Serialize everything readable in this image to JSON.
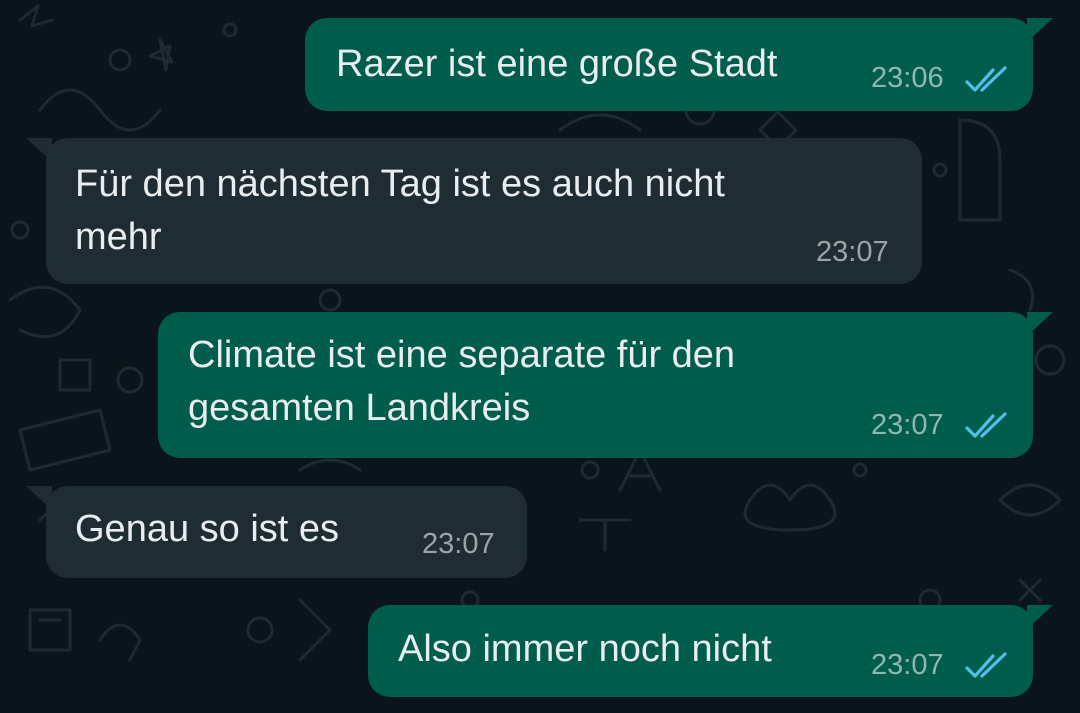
{
  "theme": {
    "background": "#0b141a",
    "outgoing_bubble": "#005c4b",
    "incoming_bubble": "#202c33",
    "text_color": "#e9edef",
    "read_receipt_color": "#53bdeb"
  },
  "messages": [
    {
      "direction": "outgoing",
      "lines": [
        "Razer ist eine große Stadt"
      ],
      "time": "23:06",
      "status": "read"
    },
    {
      "direction": "incoming",
      "lines": [
        "Für den nächsten Tag ist es auch nicht",
        "mehr"
      ],
      "time": "23:07"
    },
    {
      "direction": "outgoing",
      "lines": [
        "Climate ist eine separate für den",
        "gesamten Landkreis"
      ],
      "time": "23:07",
      "status": "read"
    },
    {
      "direction": "incoming",
      "lines": [
        "Genau so ist es"
      ],
      "time": "23:07"
    },
    {
      "direction": "outgoing",
      "lines": [
        "Also immer noch nicht"
      ],
      "time": "23:07",
      "status": "read"
    }
  ]
}
